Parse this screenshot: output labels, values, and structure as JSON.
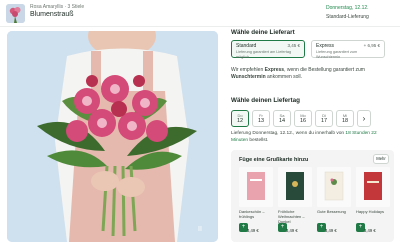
{
  "header": {
    "product_meta": "Rosa Amaryllis · 3 Stiele",
    "product_name": "Blumenstrauß",
    "delivery_date": "Donnerstag, 12.12.",
    "delivery_type": "Standard-Lieferung"
  },
  "photo": {
    "pause_icon": "pause-icon",
    "pause_glyph": "II"
  },
  "lieferart": {
    "heading": "Wähle deine Lieferart",
    "options": [
      {
        "title": "Standard",
        "price": "3,45 €",
        "subtitle": "Lieferung garantiert am Liefertag möglich",
        "selected": true
      },
      {
        "title": "Express",
        "price": "+ 6,95 €",
        "subtitle": "Lieferung garantiert zum Wunschtermin",
        "selected": false
      }
    ],
    "note_prefix": "Wir empfehlen ",
    "note_bold": "Express",
    "note_mid": ", wenn die Bestellung garantiert zum ",
    "note_bold2": "Wunschtermin",
    "note_suffix": " ankommen soll."
  },
  "liefertag": {
    "heading": "Wähle deinen Liefertag",
    "days": [
      {
        "name": "Do",
        "date": "12",
        "selected": true
      },
      {
        "name": "Fr",
        "date": "13",
        "selected": false
      },
      {
        "name": "Sa",
        "date": "14",
        "selected": false
      },
      {
        "name": "Mo",
        "date": "16",
        "selected": false
      },
      {
        "name": "Di",
        "date": "17",
        "selected": false
      },
      {
        "name": "Mi",
        "date": "18",
        "selected": false
      }
    ],
    "next_glyph": "›",
    "info_prefix": "Lieferung Donnerstag, 12.12., wenn du innerhalb von ",
    "info_highlight": "18 Stunden 22 Minuten",
    "info_suffix": " bestellst."
  },
  "cards": {
    "heading": "Füge eine Grußkarte hinzu",
    "more_label": "Mehr",
    "items": [
      {
        "name": "Dankeschön – frühlings",
        "price": "3,49 €",
        "color": "#e8a3ae"
      },
      {
        "name": "Fröhliche Weihnachten – Dunkel",
        "price": "3,49 €",
        "color": "#274a3a"
      },
      {
        "name": "Gute Besserung",
        "price": "3,49 €",
        "color": "#f3ede2"
      },
      {
        "name": "Happy Holidays",
        "price": "3,49 €",
        "color": "#c3363a"
      }
    ],
    "add_glyph": "+"
  },
  "colors": {
    "accent": "#1f7a45",
    "photo_bg": "#cfe0ef"
  }
}
